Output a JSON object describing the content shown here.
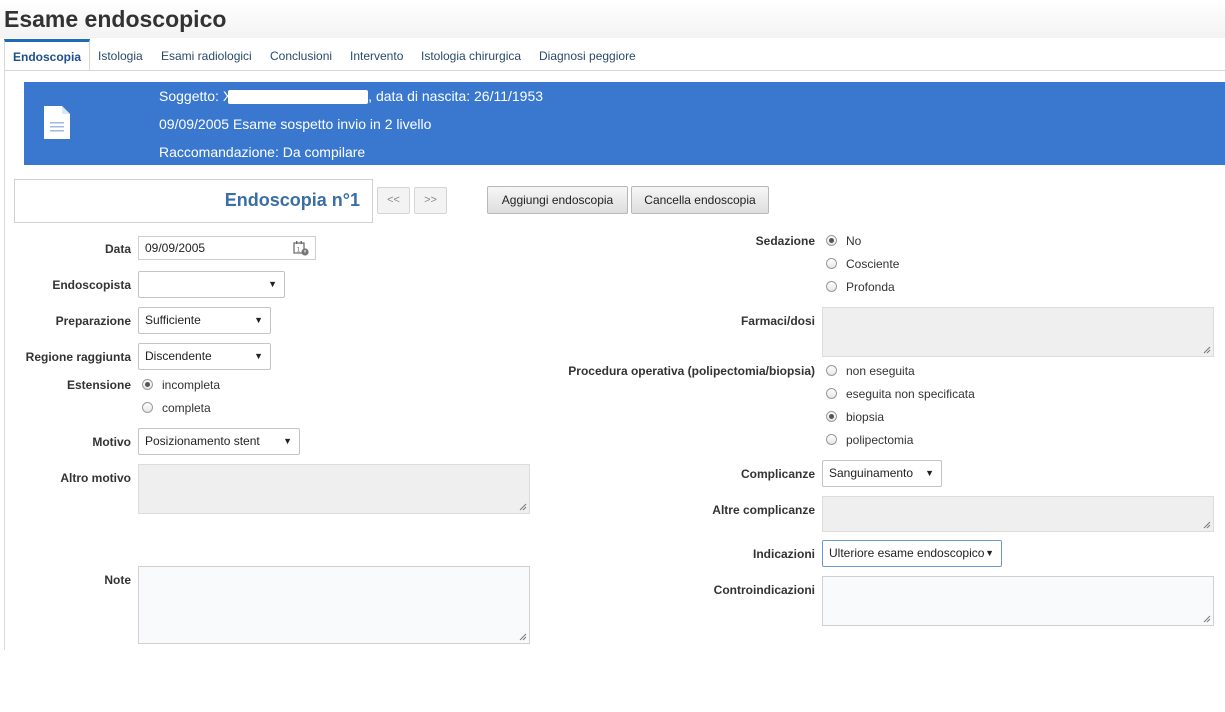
{
  "page": {
    "title": "Esame endoscopico"
  },
  "tabs": [
    {
      "label": "Endoscopia"
    },
    {
      "label": "Istologia"
    },
    {
      "label": "Esami radiologici"
    },
    {
      "label": "Conclusioni"
    },
    {
      "label": "Intervento"
    },
    {
      "label": "Istologia chirurgica"
    },
    {
      "label": "Diagnosi peggiore"
    }
  ],
  "banner": {
    "subject_prefix": "Soggetto: X",
    "subject_suffix": ", data di nascita: 26/11/1953",
    "exam": "09/09/2005 Esame sospetto invio in 2 livello",
    "recommendation": "Raccomandazione: Da compilare",
    "icon": "document-icon",
    "color": "#3a78d0"
  },
  "endoscopy": {
    "header": "Endoscopia n°1",
    "prev": "<<",
    "next": ">>",
    "add": "Aggiungi endoscopia",
    "delete": "Cancella endoscopia"
  },
  "form_left": {
    "data": {
      "label": "Data",
      "value": "09/09/2005",
      "icon": "calendar-icon"
    },
    "endoscopista": {
      "label": "Endoscopista",
      "value": ""
    },
    "preparazione": {
      "label": "Preparazione",
      "value": "Sufficiente"
    },
    "regione": {
      "label": "Regione raggiunta",
      "value": "Discendente"
    },
    "estensione": {
      "label": "Estensione",
      "options": [
        "incompleta",
        "completa"
      ],
      "selected": "incompleta"
    },
    "motivo": {
      "label": "Motivo",
      "value": "Posizionamento stent"
    },
    "altro_motivo": {
      "label": "Altro motivo"
    },
    "note": {
      "label": "Note"
    }
  },
  "form_right": {
    "sedazione": {
      "label": "Sedazione",
      "options": [
        "No",
        "Cosciente",
        "Profonda"
      ],
      "selected": "No"
    },
    "farmaci": {
      "label": "Farmaci/dosi"
    },
    "procedura": {
      "label": "Procedura operativa (polipectomia/biopsia)",
      "options": [
        "non eseguita",
        "eseguita non specificata",
        "biopsia",
        "polipectomia"
      ],
      "selected": "biopsia"
    },
    "complicanze": {
      "label": "Complicanze",
      "value": "Sanguinamento"
    },
    "altre_complicanze": {
      "label": "Altre complicanze"
    },
    "indicazioni": {
      "label": "Indicazioni",
      "value": "Ulteriore esame endoscopico"
    },
    "controindicazioni": {
      "label": "Controindicazioni"
    }
  },
  "glyphs": {
    "dropdown_arrow": "▼"
  }
}
